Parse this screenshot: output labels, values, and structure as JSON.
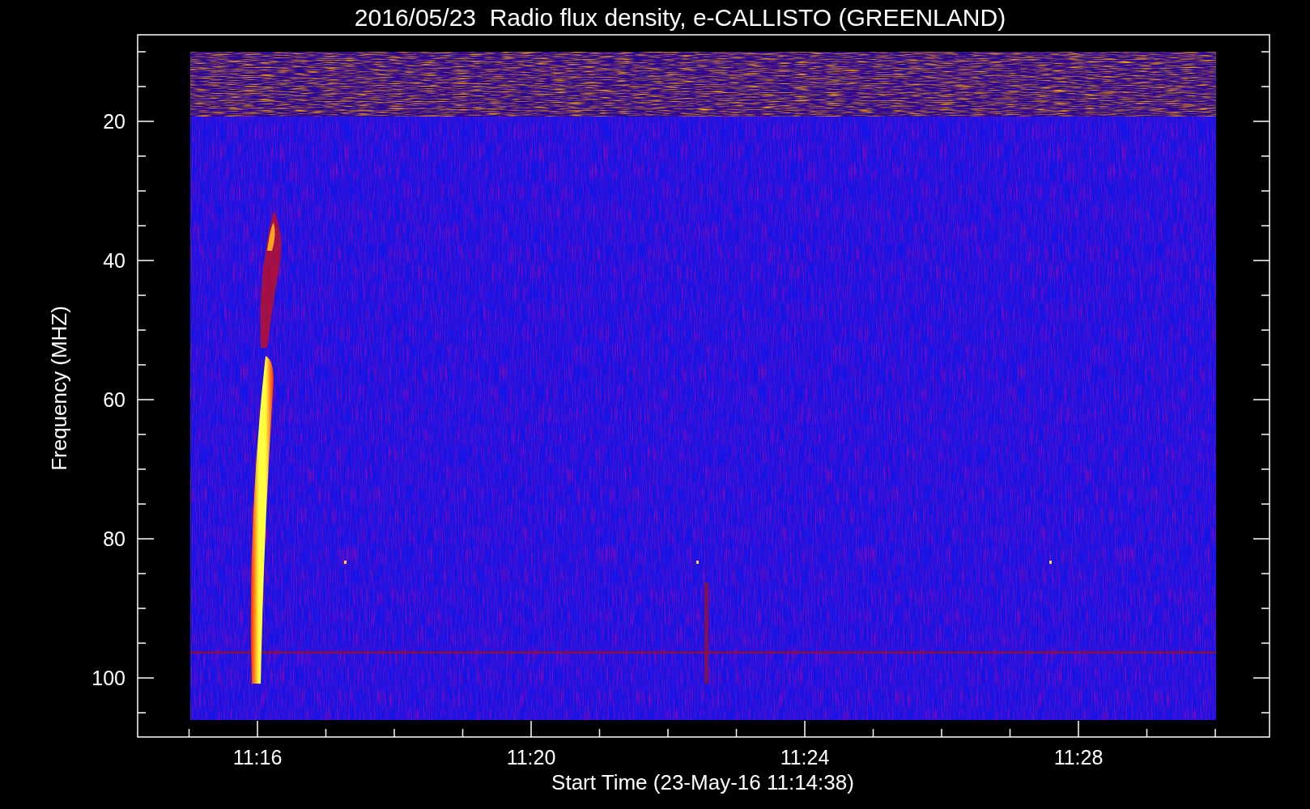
{
  "title": "2016/05/23  Radio flux density, e-CALLISTO (GREENLAND)",
  "ylabel": "Frequency (MHZ)",
  "xlabel": "Start Time (23-May-16 11:14:38)",
  "yticks": [
    "20",
    "40",
    "60",
    "80",
    "100"
  ],
  "xticks": [
    "11:16",
    "11:20",
    "11:24",
    "11:28"
  ]
}
